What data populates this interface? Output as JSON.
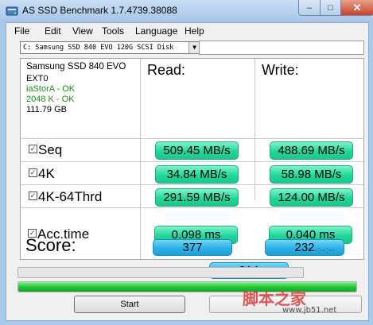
{
  "window": {
    "title": "AS SSD Benchmark 1.7.4739.38088",
    "minimize_symbol": "–",
    "maximize_symbol": "□",
    "close_symbol": "✕"
  },
  "menu": {
    "items": [
      "File",
      "Edit",
      "View",
      "Tools",
      "Language",
      "Help"
    ]
  },
  "drive_select": {
    "value": "C: Samsung SSD 840 EVO 120G SCSI Disk",
    "arrow": "▼"
  },
  "drive_info": {
    "model": "Samsung SSD 840 EVO",
    "firmware": "EXT0",
    "driver": "iaStorA - OK",
    "alignment": "2048 K - OK",
    "capacity": "111.79 GB"
  },
  "columns": {
    "read": "Read:",
    "write": "Write:"
  },
  "tests": [
    {
      "label": "Seq",
      "checked": true,
      "read": "509.45 MB/s",
      "write": "488.69 MB/s"
    },
    {
      "label": "4K",
      "checked": true,
      "read": "34.84 MB/s",
      "write": "58.98 MB/s"
    },
    {
      "label": "4K-64Thrd",
      "checked": true,
      "read": "291.59 MB/s",
      "write": "124.00 MB/s"
    },
    {
      "label": "Acc.time",
      "checked": true,
      "read": "0.098 ms",
      "write": "0.040 ms"
    }
  ],
  "score": {
    "label": "Score:",
    "read": "377",
    "write": "232",
    "total": "814"
  },
  "checkmark": "✓",
  "progress": {
    "top_fraction": 0,
    "bottom_fraction": 1,
    "elapsed": "-:--:--"
  },
  "buttons": {
    "start": "Start"
  },
  "watermark": {
    "text": "脚本之家",
    "url": "www.jb51.net"
  },
  "colors": {
    "result_green": "#22d79a",
    "score_blue": "#29b2e8",
    "ok_green": "#1a8f1a"
  },
  "icons": {
    "app": "as-ssd-drive-icon"
  }
}
